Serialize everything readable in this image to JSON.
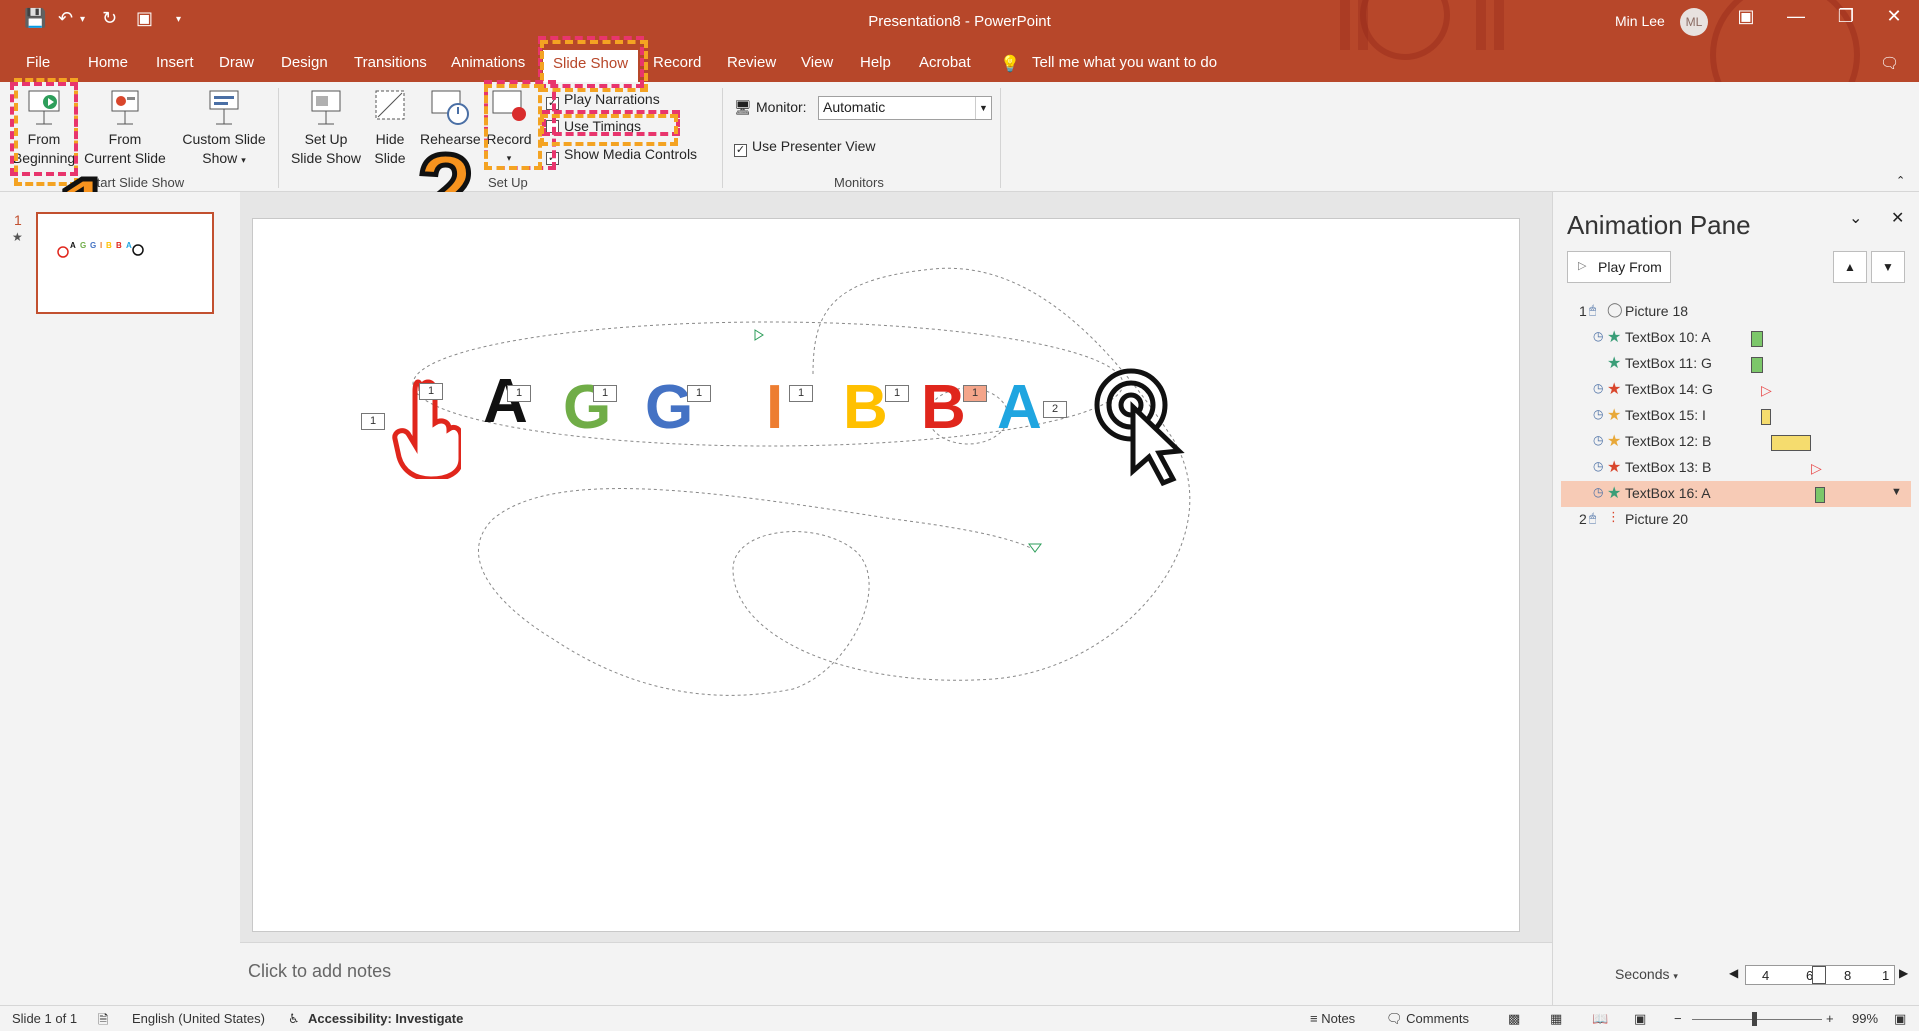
{
  "window": {
    "title": "Presentation8  -  PowerPoint",
    "user": "Min Lee",
    "user_initials": "ML",
    "accent": "#b7472a"
  },
  "tabs": [
    "File",
    "Home",
    "Insert",
    "Draw",
    "Design",
    "Transitions",
    "Animations",
    "Slide Show",
    "Record",
    "Review",
    "View",
    "Help",
    "Acrobat"
  ],
  "active_tab": "Slide Show",
  "tell_me": "Tell me what you want to do",
  "ribbon": {
    "from_beginning": [
      "From",
      "Beginning"
    ],
    "from_current": [
      "From",
      "Current Slide"
    ],
    "custom_show": [
      "Custom Slide",
      "Show"
    ],
    "start_group": "Start Slide Show",
    "setup_show": [
      "Set Up",
      "Slide Show"
    ],
    "hide_slide": [
      "Hide",
      "Slide"
    ],
    "rehearse": "Rehearse",
    "record": "Record",
    "setup_group": "Set Up",
    "play_narrations": "Play Narrations",
    "use_timings": "Use Timings",
    "show_media": "Show Media Controls",
    "monitor_label": "Monitor:",
    "monitor_value": "Automatic",
    "presenter_view": "Use Presenter View",
    "monitors_group": "Monitors"
  },
  "callouts": [
    "1",
    "2"
  ],
  "thumbnail": {
    "number": "1",
    "star": "★"
  },
  "slide": {
    "letters": [
      {
        "char": "A",
        "color": "#111111"
      },
      {
        "char": "G",
        "color": "#70ad47"
      },
      {
        "char": "G",
        "color": "#4472c4"
      },
      {
        "char": "I",
        "color": "#ed7d31"
      },
      {
        "char": "B",
        "color": "#ffc000"
      },
      {
        "char": "B",
        "color": "#e0261c"
      },
      {
        "char": "A",
        "color": "#1fa5e0"
      }
    ],
    "tags": [
      "1",
      "1",
      "1",
      "1",
      "1",
      "1",
      "1",
      "1",
      "1",
      "2"
    ]
  },
  "notes_placeholder": "Click to add notes",
  "animation_pane": {
    "title": "Animation Pane",
    "play_from": "Play From",
    "items": [
      {
        "num": "1",
        "label": "Picture 18",
        "star_color": "#777777",
        "bar": null
      },
      {
        "num": "",
        "label": "TextBox 10: A",
        "star_color": "#3a9e78",
        "bar": "green"
      },
      {
        "num": "",
        "label": "TextBox 11: G",
        "star_color": "#3a9e78",
        "bar": "green"
      },
      {
        "num": "",
        "label": "TextBox 14: G",
        "star_color": "#d9462c",
        "bar": "red"
      },
      {
        "num": "",
        "label": "TextBox 15: I",
        "star_color": "#e8a838",
        "bar": "yellow"
      },
      {
        "num": "",
        "label": "TextBox 12: B",
        "star_color": "#e8a838",
        "bar": "yellow-long"
      },
      {
        "num": "",
        "label": "TextBox 13: B",
        "star_color": "#d9462c",
        "bar": "red"
      },
      {
        "num": "",
        "label": "TextBox 16: A",
        "star_color": "#3a9e78",
        "bar": "green"
      },
      {
        "num": "2",
        "label": "Picture 20",
        "star_color": "#d9462c",
        "bar": null
      }
    ],
    "selected_index": 7,
    "seconds_label": "Seconds",
    "timeline_ticks": [
      "4",
      "6",
      "8",
      "1"
    ]
  },
  "status": {
    "slide": "Slide 1 of 1",
    "language": "English (United States)",
    "accessibility": "Accessibility: Investigate",
    "notes": "Notes",
    "comments": "Comments",
    "zoom": "99%"
  }
}
